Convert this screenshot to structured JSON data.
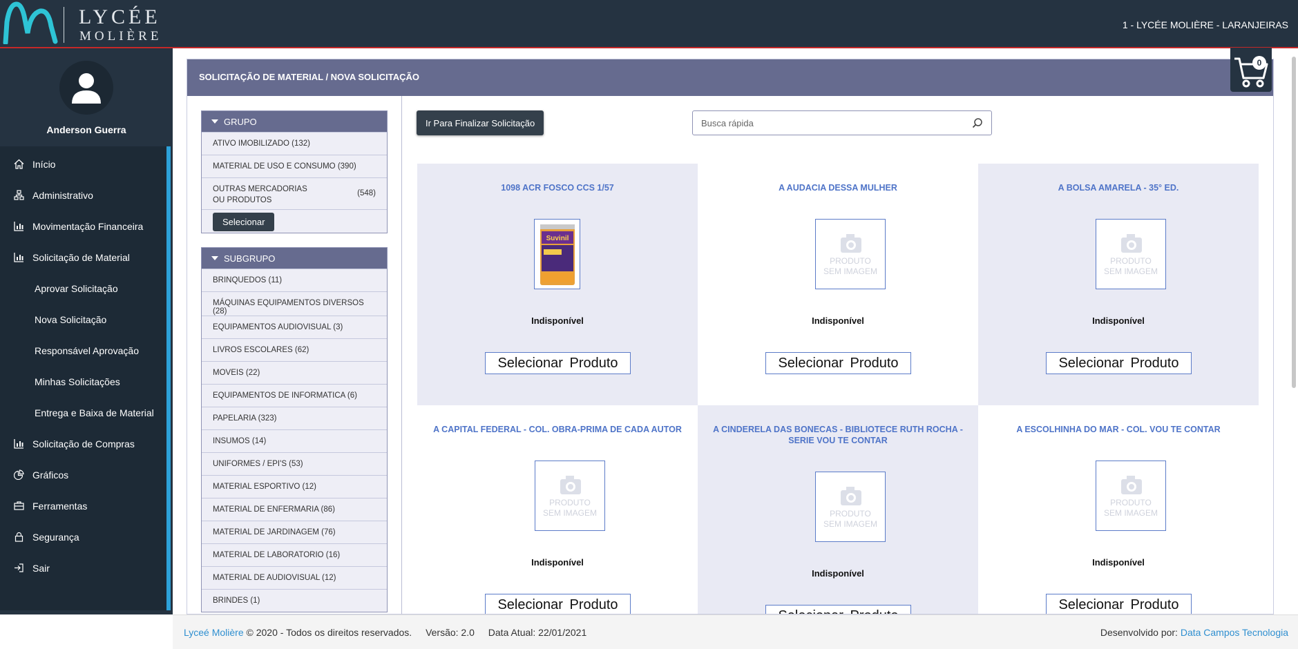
{
  "header": {
    "logo_line1": "LYCÉE",
    "logo_line2": "MOLIÈRE",
    "school": "1 - LYCÉE MOLIÈRE - LARANJEIRAS"
  },
  "user": {
    "name": "Anderson Guerra"
  },
  "menu": [
    {
      "label": "Início",
      "icon": "home-icon"
    },
    {
      "label": "Administrativo",
      "icon": "sitemap-icon"
    },
    {
      "label": "Movimentação Financeira",
      "icon": "bar-chart-icon"
    },
    {
      "label": "Solicitação de Material",
      "icon": "bar-chart-icon"
    },
    {
      "label": "Aprovar Solicitação"
    },
    {
      "label": "Nova Solicitação"
    },
    {
      "label": "Responsável Aprovação"
    },
    {
      "label": "Minhas Solicitações"
    },
    {
      "label": "Entrega e Baixa de Material"
    },
    {
      "label": "Solicitação de Compras",
      "icon": "bar-chart-icon"
    },
    {
      "label": "Gráficos",
      "icon": "pie-chart-icon"
    },
    {
      "label": "Ferramentas",
      "icon": "briefcase-icon"
    },
    {
      "label": "Segurança",
      "icon": "lock-icon"
    },
    {
      "label": "Sair",
      "icon": "sign-out-icon"
    }
  ],
  "panel": {
    "title": "SOLICITAÇÃO DE MATERIAL / NOVA SOLICITAÇÃO"
  },
  "cart": {
    "count": "0"
  },
  "grupo": {
    "title": "GRUPO",
    "items": [
      {
        "label": "ATIVO IMOBILIZADO (132)"
      },
      {
        "label": "MATERIAL DE USO E CONSUMO (390)"
      },
      {
        "label": "OUTRAS MERCADORIAS OU PRODUTOS",
        "count": "(548)"
      }
    ],
    "select_label": "Selecionar"
  },
  "subgrupo": {
    "title": "SUBGRUPO",
    "items": [
      "BRINQUEDOS (11)",
      "MÁQUINAS EQUIPAMENTOS DIVERSOS (28)",
      "EQUIPAMENTOS AUDIOVISUAL (3)",
      "LIVROS ESCOLARES (62)",
      "MOVEIS (22)",
      "EQUIPAMENTOS DE INFORMATICA (6)",
      "PAPELARIA (323)",
      "INSUMOS (14)",
      "UNIFORMES / EPI'S (53)",
      "MATERIAL ESPORTIVO (12)",
      "MATERIAL DE ENFERMARIA (86)",
      "MATERIAL DE JARDINAGEM (76)",
      "MATERIAL DE LABORATORIO (16)",
      "MATERIAL DE AUDIOVISUAL (12)",
      "BRINDES (1)"
    ]
  },
  "toolbar": {
    "finalize_label": "Ir Para Finalizar Solicitação",
    "search_placeholder": "Busca rápida"
  },
  "no_image_text": [
    "PRODUTO",
    "SEM IMAGEM"
  ],
  "products": [
    {
      "title": "1098 ACR FOSCO CCS 1/57",
      "status": "Indisponível",
      "button": "Selecionar Produto",
      "image": "paint-can",
      "product_label": "Suvinil"
    },
    {
      "title": "A AUDACIA DESSA MULHER",
      "status": "Indisponível",
      "button": "Selecionar Produto",
      "image": "none"
    },
    {
      "title": "A BOLSA AMARELA - 35° ED.",
      "status": "Indisponível",
      "button": "Selecionar Produto",
      "image": "none"
    },
    {
      "title": "A CAPITAL FEDERAL - COL. OBRA-PRIMA DE CADA AUTOR",
      "status": "Indisponível",
      "button": "Selecionar Produto",
      "image": "none"
    },
    {
      "title": "A CINDERELA DAS BONECAS - BIBLIOTECE RUTH ROCHA - SERIE VOU TE CONTAR",
      "status": "Indisponível",
      "button": "Selecionar Produto",
      "image": "none"
    },
    {
      "title": "A ESCOLHINHA DO MAR - COL. VOU TE CONTAR",
      "status": "Indisponível",
      "button": "Selecionar Produto",
      "image": "none"
    }
  ],
  "footer": {
    "brand": "Lyceé Molière",
    "copyright": "© 2020 - Todos os direitos reservados.",
    "version": "Versão: 2.0",
    "date": "Data Atual: 22/01/2021",
    "dev_label": "Desenvolvido por:",
    "dev_name": "Data Campos Tecnologia"
  },
  "colors": {
    "topbar": "#253341",
    "header_bar": "#666b8f",
    "accent": "#2da1d9",
    "product_title": "#4f74c8",
    "card_shade": "#e9eaf4"
  }
}
